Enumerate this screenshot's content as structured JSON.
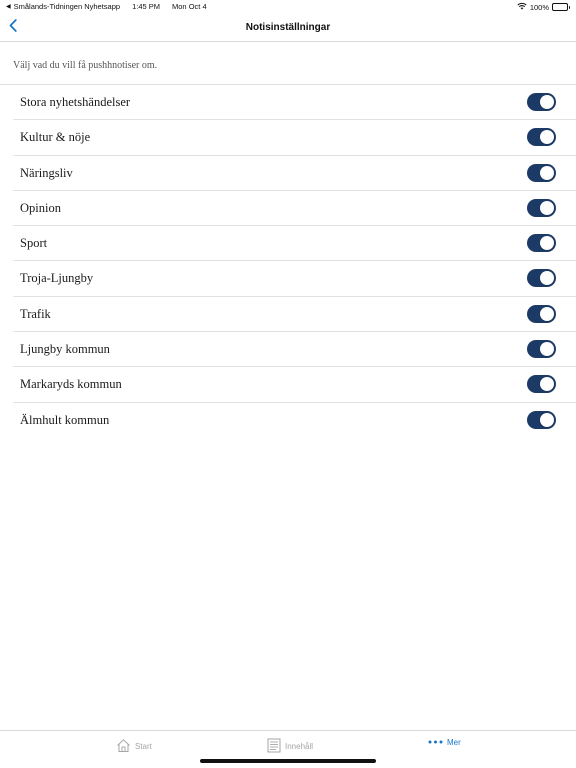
{
  "status_bar": {
    "back_app": "Smålands-Tidningen Nyhetsapp",
    "time": "1:45 PM",
    "date": "Mon Oct 4",
    "battery_text": "100%",
    "battery_level": 1.0
  },
  "nav": {
    "title": "Notisinställningar"
  },
  "description": "Välj vad du vill få pushhnotiser om.",
  "settings": [
    {
      "label": "Stora nyhetshändelser",
      "enabled": true
    },
    {
      "label": "Kultur & nöje",
      "enabled": true
    },
    {
      "label": "Näringsliv",
      "enabled": true
    },
    {
      "label": "Opinion",
      "enabled": true
    },
    {
      "label": "Sport",
      "enabled": true
    },
    {
      "label": "Troja-Ljungby",
      "enabled": true
    },
    {
      "label": "Trafik",
      "enabled": true
    },
    {
      "label": "Ljungby kommun",
      "enabled": true
    },
    {
      "label": "Markaryds kommun",
      "enabled": true
    },
    {
      "label": "Älmhult kommun",
      "enabled": true
    }
  ],
  "tabs": [
    {
      "label": "Start",
      "icon": "home-icon",
      "active": false
    },
    {
      "label": "Innehåll",
      "icon": "document-list-icon",
      "active": false
    },
    {
      "label": "Mer",
      "icon": "more-dots-icon",
      "active": true
    }
  ],
  "colors": {
    "toggle_on": "#1c3a66",
    "accent": "#1a75c9",
    "tab_inactive": "#a6a6a6"
  }
}
